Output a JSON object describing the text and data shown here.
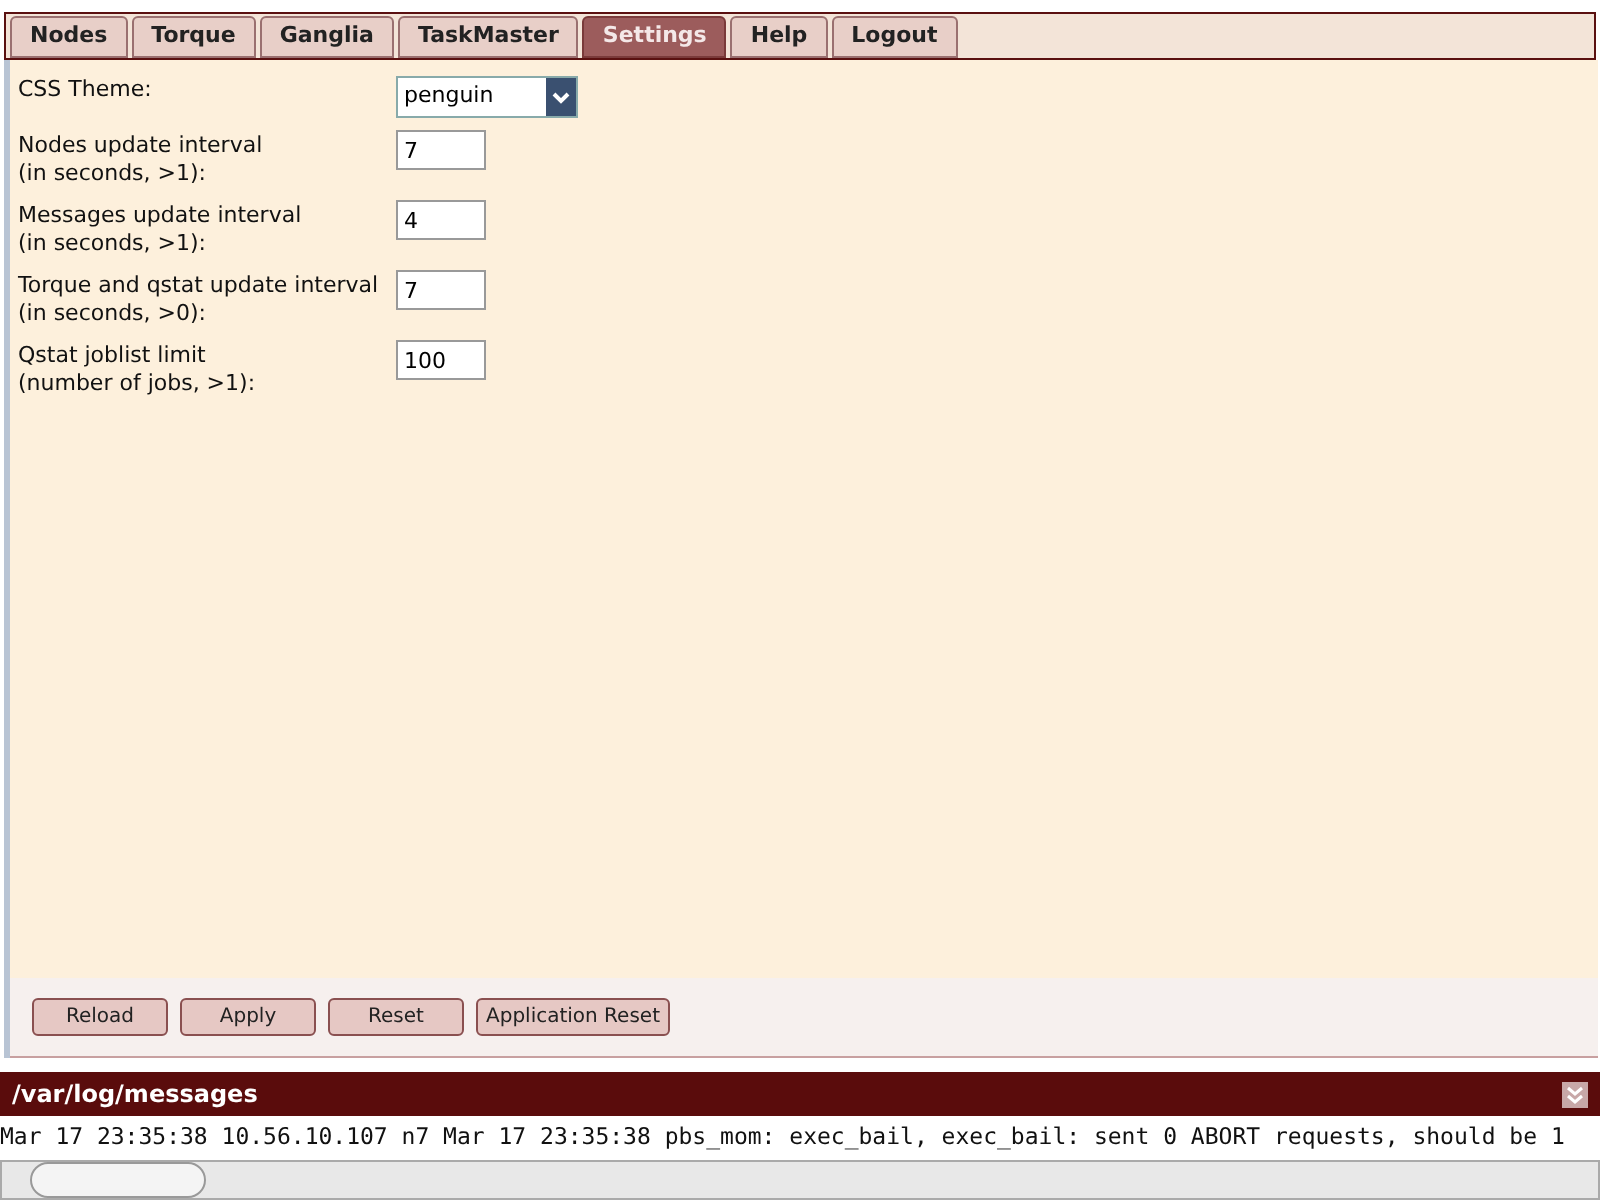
{
  "tabs": [
    {
      "label": "Nodes",
      "selected": false
    },
    {
      "label": "Torque",
      "selected": false
    },
    {
      "label": "Ganglia",
      "selected": false
    },
    {
      "label": "TaskMaster",
      "selected": false
    },
    {
      "label": "Settings",
      "selected": true
    },
    {
      "label": "Help",
      "selected": false
    },
    {
      "label": "Logout",
      "selected": false
    }
  ],
  "settings": [
    {
      "kind": "select",
      "label": "CSS Theme:",
      "value": "penguin"
    },
    {
      "kind": "text",
      "label": "Nodes update interval",
      "hint": "(in seconds, >1):",
      "value": "7"
    },
    {
      "kind": "text",
      "label": "Messages update interval",
      "hint": "(in seconds, >1):",
      "value": "4"
    },
    {
      "kind": "text",
      "label": "Torque and qstat update interval",
      "hint": "(in seconds, >0):",
      "value": "7"
    },
    {
      "kind": "text",
      "label": "Qstat joblist limit",
      "hint": "(number of jobs, >1):",
      "value": "100"
    }
  ],
  "buttons": [
    "Reload",
    "Apply",
    "Reset",
    "Application Reset"
  ],
  "log": {
    "title": "/var/log/messages",
    "lines": [
      "Mar 17 23:35:38 10.56.10.107 n7 Mar 17 23:35:38 pbs_mom: exec_bail, exec_bail: sent 0 ABORT requests, should be 1"
    ]
  }
}
